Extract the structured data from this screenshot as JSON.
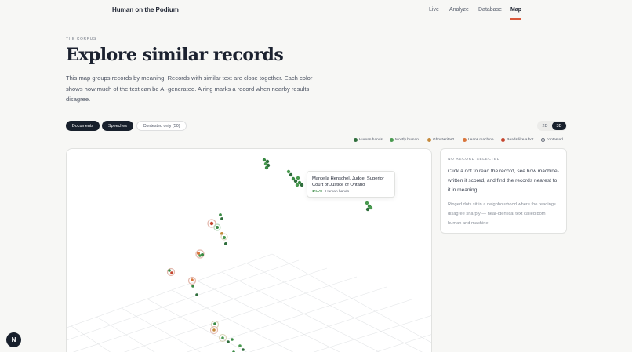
{
  "header": {
    "brand": "Human on the Podium",
    "nav": [
      "Live",
      "Analyze",
      "Database",
      "Map"
    ],
    "active_nav": "Map",
    "accent": "#d9583b"
  },
  "hero": {
    "eyebrow": "THE CORPUS",
    "title": "Explore similar records",
    "lead": "This map groups records by meaning. Records with similar text are close together. Each color shows how much of the text can be AI-generated. A ring marks a record when nearby results disagree."
  },
  "filters": {
    "chips": [
      "Documents",
      "Speeches",
      "Contested only (50)"
    ],
    "view_toggle": [
      "2D",
      "3D"
    ],
    "active_view": "3D"
  },
  "legend": [
    {
      "label": "Human hands",
      "color": "#2f6e3c"
    },
    {
      "label": "Mostly human",
      "color": "#4a9a50"
    },
    {
      "label": "Ghostwriter?",
      "color": "#c58a3d"
    },
    {
      "label": "Leans machine",
      "color": "#d9753b"
    },
    {
      "label": "Reads like a bot",
      "color": "#c5452e"
    },
    {
      "label": "contested",
      "color": "#5b6270"
    }
  ],
  "tooltip": {
    "title": "Marcella Henschel, Judge, Superior Court of Justice of Ontario",
    "score": "1% AI",
    "category": "· Human hands"
  },
  "side_panel": {
    "eyebrow": "NO RECORD SELECTED",
    "body": "Click a dot to read the record, see how machine-written it scored, and find the records nearest to it in meaning.",
    "note": "Ringed dots sit in a neighbourhood where the readings disagree sharply — near-identical text called both human and machine."
  },
  "fab_label": "N"
}
